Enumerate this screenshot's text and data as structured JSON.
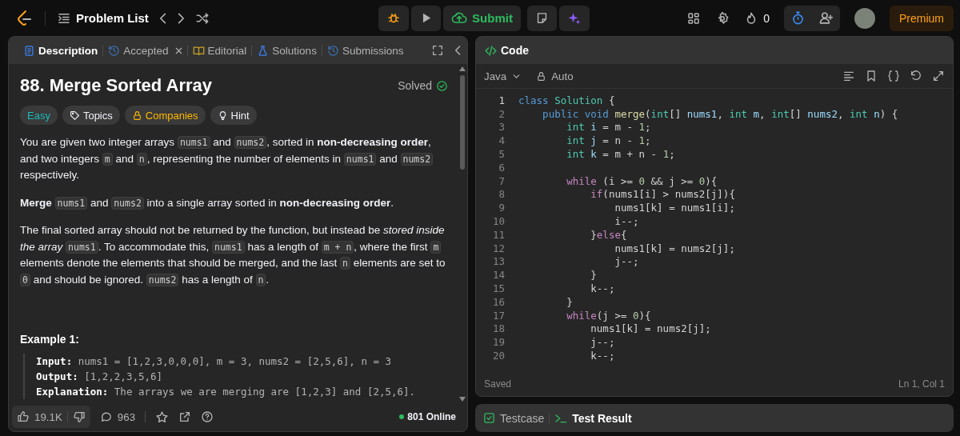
{
  "top_bar": {
    "problem_list": "Problem List",
    "submit": "Submit",
    "streak": "0",
    "premium": "Premium"
  },
  "left_tabs": [
    {
      "label": "Description",
      "kind": "doc",
      "selected": true,
      "closable": false
    },
    {
      "label": "Accepted",
      "kind": "history",
      "selected": false,
      "closable": true
    },
    {
      "label": "Editorial",
      "kind": "book",
      "selected": false,
      "closable": false
    },
    {
      "label": "Solutions",
      "kind": "flask",
      "selected": false,
      "closable": false
    },
    {
      "label": "Submissions",
      "kind": "history",
      "selected": false,
      "closable": false
    }
  ],
  "problem": {
    "title": "88. Merge Sorted Array",
    "status": "Solved",
    "tags": [
      {
        "label": "Easy",
        "kind": "plain",
        "color": "#1cbaba"
      },
      {
        "label": "Topics",
        "kind": "tag",
        "color": "#eff1f6"
      },
      {
        "label": "Companies",
        "kind": "lock",
        "color": "#ffb800"
      },
      {
        "label": "Hint",
        "kind": "bulb",
        "color": "#eff1f6"
      }
    ],
    "paragraphs": [
      [
        {
          "kind": "text",
          "text": "You are given two integer arrays "
        },
        {
          "kind": "code",
          "text": "nums1"
        },
        {
          "kind": "text",
          "text": " and "
        },
        {
          "kind": "code",
          "text": "nums2"
        },
        {
          "kind": "text",
          "text": ", sorted in **non-decreasing order**, and two integers "
        },
        {
          "kind": "code",
          "text": "m"
        },
        {
          "kind": "text",
          "text": " and "
        },
        {
          "kind": "code",
          "text": "n"
        },
        {
          "kind": "text",
          "text": ", representing the number of elements in "
        },
        {
          "kind": "code",
          "text": "nums1"
        },
        {
          "kind": "text",
          "text": " and "
        },
        {
          "kind": "code",
          "text": "nums2"
        },
        {
          "kind": "text",
          "text": " respectively."
        }
      ],
      [
        {
          "kind": "text",
          "text": "**Merge** "
        },
        {
          "kind": "code",
          "text": "nums1"
        },
        {
          "kind": "text",
          "text": " and "
        },
        {
          "kind": "code",
          "text": "nums2"
        },
        {
          "kind": "text",
          "text": " into a single array sorted in **non-decreasing order**."
        }
      ],
      [
        {
          "kind": "text",
          "text": "The final sorted array should not be returned by the function, but instead be *stored inside the array* "
        },
        {
          "kind": "code",
          "text": "nums1"
        },
        {
          "kind": "text",
          "text": ". To accommodate this, "
        },
        {
          "kind": "code",
          "text": "nums1"
        },
        {
          "kind": "text",
          "text": " has a length of "
        },
        {
          "kind": "code",
          "text": "m + n"
        },
        {
          "kind": "text",
          "text": ", where the first "
        },
        {
          "kind": "code",
          "text": "m"
        },
        {
          "kind": "text",
          "text": " elements denote the elements that should be merged, and the last "
        },
        {
          "kind": "code",
          "text": "n"
        },
        {
          "kind": "text",
          "text": " elements are set to "
        },
        {
          "kind": "code",
          "text": "0"
        },
        {
          "kind": "text",
          "text": " and should be ignored. "
        },
        {
          "kind": "code",
          "text": "nums2"
        },
        {
          "kind": "text",
          "text": " has a length of "
        },
        {
          "kind": "code",
          "text": "n"
        },
        {
          "kind": "text",
          "text": "."
        }
      ]
    ],
    "example": {
      "title": "Example 1:",
      "lines": [
        {
          "label": "Input:",
          "value": "nums1 = [1,2,3,0,0,0], m = 3, nums2 = [2,5,6], n = 3"
        },
        {
          "label": "Output:",
          "value": "[1,2,2,3,5,6]"
        },
        {
          "label": "Explanation:",
          "value": "The arrays we are merging are [1,2,3] and [2,5,6]."
        }
      ]
    }
  },
  "footer": {
    "likes": "19.1K",
    "comments": "963",
    "online": "801 Online"
  },
  "code_panel": {
    "title": "Code",
    "language": "Java",
    "mode": "Auto",
    "status": "Saved",
    "cursor": "Ln 1, Col 1",
    "lines": [
      {
        "number": "1",
        "tokens": [
          {
            "kind": "keyword",
            "text": "class "
          },
          {
            "kind": "type",
            "text": "Solution"
          },
          {
            "kind": "plain",
            "text": " {"
          }
        ]
      },
      {
        "number": "2",
        "tokens": [
          {
            "kind": "keyword",
            "text": "    public "
          },
          {
            "kind": "keyword",
            "text": "void "
          },
          {
            "kind": "function",
            "text": "merge"
          },
          {
            "kind": "plain",
            "text": "("
          },
          {
            "kind": "type",
            "text": "int"
          },
          {
            "kind": "plain",
            "text": "[] "
          },
          {
            "kind": "variable",
            "text": "nums1"
          },
          {
            "kind": "plain",
            "text": ", "
          },
          {
            "kind": "type",
            "text": "int "
          },
          {
            "kind": "variable",
            "text": "m"
          },
          {
            "kind": "plain",
            "text": ", "
          },
          {
            "kind": "type",
            "text": "int"
          },
          {
            "kind": "plain",
            "text": "[] "
          },
          {
            "kind": "variable",
            "text": "nums2"
          },
          {
            "kind": "plain",
            "text": ", "
          },
          {
            "kind": "type",
            "text": "int "
          },
          {
            "kind": "variable",
            "text": "n"
          },
          {
            "kind": "plain",
            "text": ") {"
          }
        ]
      },
      {
        "number": "3",
        "tokens": [
          {
            "kind": "type",
            "text": "        int "
          },
          {
            "kind": "variable",
            "text": "i"
          },
          {
            "kind": "plain",
            "text": " = m - "
          },
          {
            "kind": "number",
            "text": "1"
          },
          {
            "kind": "plain",
            "text": ";"
          }
        ]
      },
      {
        "number": "4",
        "tokens": [
          {
            "kind": "type",
            "text": "        int "
          },
          {
            "kind": "variable",
            "text": "j"
          },
          {
            "kind": "plain",
            "text": " = n - "
          },
          {
            "kind": "number",
            "text": "1"
          },
          {
            "kind": "plain",
            "text": ";"
          }
        ]
      },
      {
        "number": "5",
        "tokens": [
          {
            "kind": "type",
            "text": "        int "
          },
          {
            "kind": "variable",
            "text": "k"
          },
          {
            "kind": "plain",
            "text": " = m + n - "
          },
          {
            "kind": "number",
            "text": "1"
          },
          {
            "kind": "plain",
            "text": ";"
          }
        ]
      },
      {
        "number": "6"
      },
      {
        "number": "7",
        "tokens": [
          {
            "kind": "control",
            "text": "        while"
          },
          {
            "kind": "plain",
            "text": " (i >= "
          },
          {
            "kind": "number",
            "text": "0"
          },
          {
            "kind": "plain",
            "text": " && j >= "
          },
          {
            "kind": "number",
            "text": "0"
          },
          {
            "kind": "plain",
            "text": "){"
          }
        ]
      },
      {
        "number": "8",
        "tokens": [
          {
            "kind": "control",
            "text": "            if"
          },
          {
            "kind": "plain",
            "text": "(nums1[i] > nums2[j]){"
          }
        ]
      },
      {
        "number": "9",
        "tokens": [
          {
            "kind": "plain",
            "text": "                nums1[k] = nums1[i];"
          }
        ]
      },
      {
        "number": "10",
        "tokens": [
          {
            "kind": "plain",
            "text": "                i--;"
          }
        ]
      },
      {
        "number": "11",
        "tokens": [
          {
            "kind": "plain",
            "text": "            }"
          },
          {
            "kind": "control",
            "text": "else"
          },
          {
            "kind": "plain",
            "text": "{"
          }
        ]
      },
      {
        "number": "12",
        "tokens": [
          {
            "kind": "plain",
            "text": "                nums1[k] = nums2[j];"
          }
        ]
      },
      {
        "number": "13",
        "tokens": [
          {
            "kind": "plain",
            "text": "                j--;"
          }
        ]
      },
      {
        "number": "14",
        "tokens": [
          {
            "kind": "plain",
            "text": "            }"
          }
        ]
      },
      {
        "number": "15",
        "tokens": [
          {
            "kind": "plain",
            "text": "            k--;"
          }
        ]
      },
      {
        "number": "16",
        "tokens": [
          {
            "kind": "plain",
            "text": "        }"
          }
        ]
      },
      {
        "number": "17",
        "tokens": [
          {
            "kind": "control",
            "text": "        while"
          },
          {
            "kind": "plain",
            "text": "(j >= "
          },
          {
            "kind": "number",
            "text": "0"
          },
          {
            "kind": "plain",
            "text": "){"
          }
        ]
      },
      {
        "number": "18",
        "tokens": [
          {
            "kind": "plain",
            "text": "            nums1[k] = nums2[j];"
          }
        ]
      },
      {
        "number": "19",
        "tokens": [
          {
            "kind": "plain",
            "text": "            j--;"
          }
        ]
      },
      {
        "number": "20",
        "tokens": [
          {
            "kind": "plain",
            "text": "            k--;"
          }
        ]
      }
    ]
  },
  "bottom_tabs": [
    {
      "label": "Testcase",
      "kind": "check",
      "selected": false
    },
    {
      "label": "Test Result",
      "kind": "terminal",
      "selected": true
    }
  ]
}
